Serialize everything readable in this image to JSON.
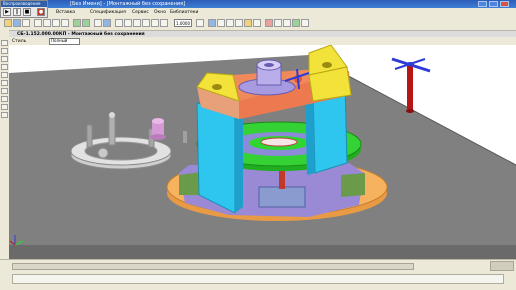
{
  "window": {
    "title": "[Без Имени] - [Монтажный без сохранения]",
    "controls": [
      "minimize",
      "maximize",
      "close"
    ]
  },
  "playback_panel": {
    "title": "Воспроизведение",
    "buttons": [
      "play-icon",
      "pause-icon",
      "stop-icon",
      "record-icon"
    ]
  },
  "menu": {
    "items": [
      "Вставка",
      "Спецификация",
      "Сервис",
      "Окно",
      "Библиотеки"
    ]
  },
  "toolbar": {
    "zoom_value": "1.0000"
  },
  "document": {
    "title": "СБ-1.152.000.00КП - Монтажный без сохранения"
  },
  "properties": {
    "label": "Стиль",
    "style_value": "Полный"
  },
  "colors": {
    "viewport_bg": "#ffffff",
    "platform": "#7f7f7f",
    "beam_yellow": "#f2e23a",
    "beam_orange": "#f08a5d",
    "column_cyan": "#2ec5ef",
    "ring_green": "#2ed62e",
    "base_orange": "#f6b25e",
    "lilac": "#a79ae0",
    "axis_blue": "#2e3bd6",
    "axis_red": "#b81414"
  }
}
